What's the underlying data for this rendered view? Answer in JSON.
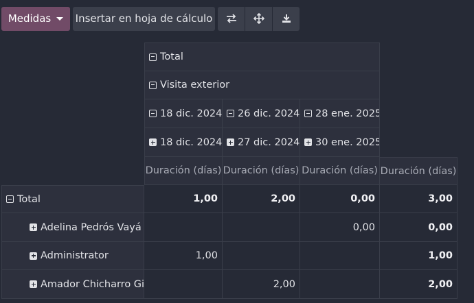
{
  "toolbar": {
    "measures_label": "Medidas",
    "insert_label": "Insertar en hoja de cálculo",
    "icons": [
      "flip-axis-icon",
      "expand-all-icon",
      "download-icon"
    ]
  },
  "pivot": {
    "col_total": "Total",
    "col_group": "Visita exterior",
    "col_level3": [
      "18 dic. 2024",
      "26 dic. 2024",
      "28 ene. 2025"
    ],
    "col_level4": [
      "18 dic. 2024",
      "27 dic. 2024",
      "30 ene. 2025"
    ],
    "measure_label": "Duración (días)",
    "rows": [
      {
        "label": "Total",
        "values": [
          "1,00",
          "2,00",
          "0,00",
          "3,00"
        ]
      },
      {
        "label": "Adelina Pedrós Vayá",
        "values": [
          "",
          "",
          "0,00",
          "0,00"
        ]
      },
      {
        "label": "Administrator",
        "values": [
          "1,00",
          "",
          "",
          "1,00"
        ]
      },
      {
        "label": "Amador Chicharro Gil",
        "values": [
          "",
          "2,00",
          "",
          "2,00"
        ]
      }
    ]
  }
}
